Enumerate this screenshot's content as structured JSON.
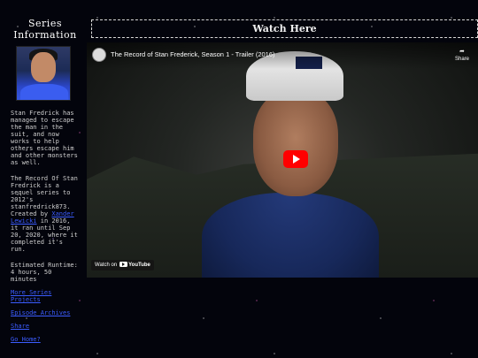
{
  "sidebar": {
    "title": "Series Information",
    "description_1": "Stan Fredrick has managed to escape the man in the suit, and now works to help others escape him and other monsters as well.",
    "description_2_pre": "The Record Of Stan Fredrick is a sequel series to 2012's stanfredrick873. Created by",
    "creator_link": "Xander Lewicki",
    "description_2_post": "in 2016, it ran until Sep 20, 2020, where it completed it's run.",
    "runtime": "Estimated Runtime: 4 hours, 50 minutes",
    "links": [
      {
        "label": "More Series Projects"
      },
      {
        "label": "Episode Archives"
      },
      {
        "label": "Share"
      },
      {
        "label": "Go Home?"
      }
    ]
  },
  "main": {
    "header": "Watch Here",
    "video": {
      "title": "The Record of Stan Frederick, Season 1 - Trailer (2016)",
      "share_label": "Share",
      "share_icon": "share-arrow-icon",
      "watch_on_label": "Watch on",
      "youtube_label": "YouTube"
    }
  }
}
